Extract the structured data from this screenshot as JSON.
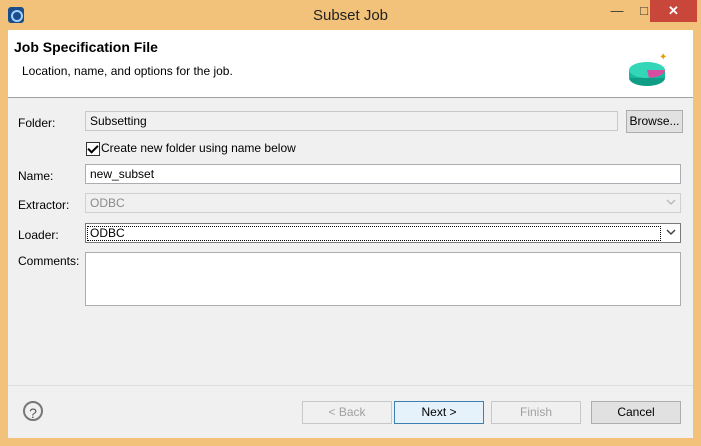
{
  "window": {
    "title": "Subset Job",
    "controls": {
      "minimize": "—",
      "maximize": "□",
      "close": "✕"
    }
  },
  "header": {
    "title": "Job Specification File",
    "description": "Location, name, and options for the job."
  },
  "form": {
    "folder": {
      "label": "Folder:",
      "value": "Subsetting",
      "browse_label": "Browse..."
    },
    "create_folder": {
      "label": "Create new folder using name below",
      "checked": true
    },
    "name": {
      "label": "Name:",
      "value": "new_subset"
    },
    "extractor": {
      "label": "Extractor:",
      "value": "ODBC"
    },
    "loader": {
      "label": "Loader:",
      "value": "ODBC"
    },
    "comments": {
      "label": "Comments:",
      "value": ""
    }
  },
  "footer": {
    "help_icon": "?",
    "back_label": "< Back",
    "next_label": "Next >",
    "finish_label": "Finish",
    "cancel_label": "Cancel"
  },
  "colors": {
    "titlebar": "#f2c27a",
    "close_button": "#c9463a",
    "dialog_bg": "#f0f0f0"
  }
}
